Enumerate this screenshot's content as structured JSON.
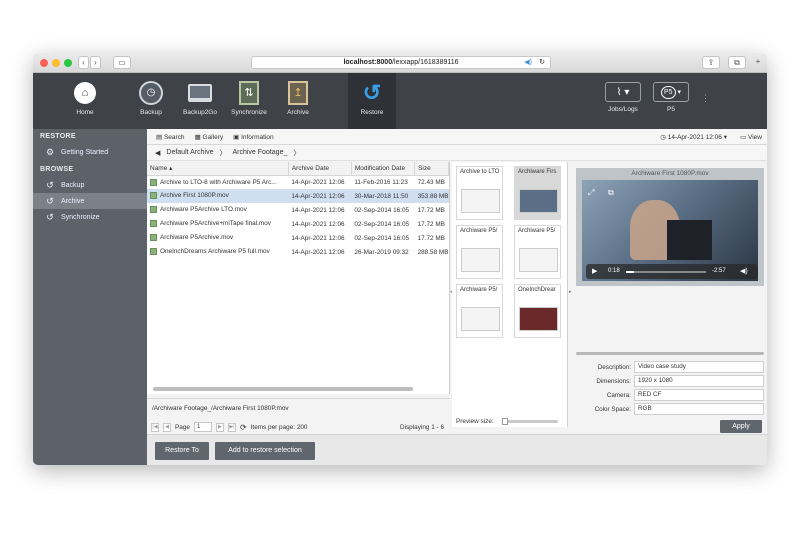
{
  "browser": {
    "url_host": "localhost:8000",
    "url_path": "/lexxapp/1618389116"
  },
  "toolbar": {
    "home": "Home",
    "backup": "Backup",
    "backup2go": "Backup2Go",
    "synchronize": "Synchronize",
    "archive": "Archive",
    "restore": "Restore",
    "jobs_logs": "Jobs/Logs",
    "p5": "P5",
    "p5_logo": "P5"
  },
  "sidebar": {
    "restore_heading": "RESTORE",
    "getting_started": "Getting Started",
    "browse_heading": "BROWSE",
    "items": [
      {
        "label": "Backup"
      },
      {
        "label": "Archive"
      },
      {
        "label": "Synchronize"
      }
    ]
  },
  "subtoolbar": {
    "search": "Search",
    "gallery": "Gallery",
    "information": "Information",
    "date": "14-Apr-2021 12:06",
    "view": "View"
  },
  "breadcrumb": {
    "root": "Default Archive",
    "folder": "Archive Footage_"
  },
  "table": {
    "headers": [
      "Name",
      "Archive Date",
      "Modification Date",
      "Size"
    ],
    "rows": [
      [
        "Archive to LTO-8 with Archiware P5 Arc...",
        "14-Apr-2021 12:06",
        "11-Feb-2016 11:23",
        "72.43 MB"
      ],
      [
        "Archive First 1080P.mov",
        "14-Apr-2021 12:06",
        "30-Mar-2018 11:50",
        "353.88 MB"
      ],
      [
        "Archiware P5Archive LTO.mov",
        "14-Apr-2021 12:06",
        "02-Sep-2014 16:05",
        "17.72 MB"
      ],
      [
        "Archiware P5Archive+miTape final.mov",
        "14-Apr-2021 12:06",
        "02-Sep-2014 16:05",
        "17.72 MB"
      ],
      [
        "Archiware P5Archive.mov",
        "14-Apr-2021 12:06",
        "02-Sep-2014 16:05",
        "17.72 MB"
      ],
      [
        "OneInchDreams Archiware P5 full.mov",
        "14-Apr-2021 12:06",
        "26-Mar-2019 09:32",
        "288.58 MB"
      ]
    ]
  },
  "path": "/Archiware Footage_/Archiware First 1080P.mov",
  "pager": {
    "page_label": "Page",
    "page_value": "1",
    "items_per_page": "Items per page: 200",
    "displaying": "Displaying 1 - 6"
  },
  "thumbs": [
    "Archive to LTO",
    "Archiware Firs",
    "Archiware P5/",
    "Archiware P5/",
    "Archiware P5/",
    "OneInchDrear"
  ],
  "preview": {
    "title": "Archiware First 1080P.mov",
    "time_elapsed": "0:18",
    "time_remaining": "-2:57",
    "progress": 0.1,
    "preview_size_label": "Preview size:"
  },
  "properties": [
    {
      "label": "Description:",
      "value": "Video case study"
    },
    {
      "label": "Dimensions:",
      "value": "1920 x 1080"
    },
    {
      "label": "Camera:",
      "value": "RED CF"
    },
    {
      "label": "Color Space:",
      "value": "RGB"
    }
  ],
  "buttons": {
    "apply": "Apply",
    "restore_to": "Restore To",
    "add_to_restore": "Add to restore selection"
  }
}
